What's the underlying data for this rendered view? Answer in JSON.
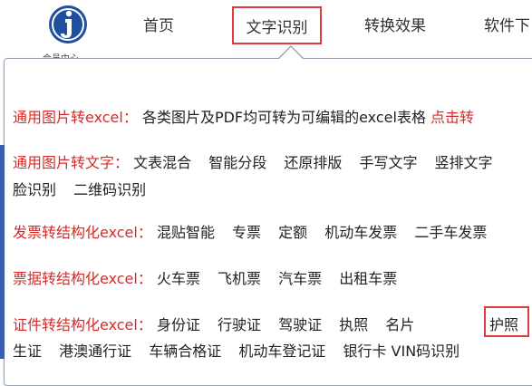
{
  "nav": {
    "logo_caption": "会员中心",
    "items": [
      "首页",
      "文字识别",
      "转换效果",
      "软件下"
    ],
    "active": "文字识别"
  },
  "menu": {
    "row1": {
      "title": "通用图片转excel：",
      "text": "各类图片及PDF均可转为可编辑的excel表格",
      "accent": "点击转"
    },
    "row2": {
      "title": "通用图片转文字：",
      "items": [
        "文表混合",
        "智能分段",
        "还原排版",
        "手写文字",
        "竖排文字"
      ],
      "cont": [
        "脸识别",
        "二维码识别"
      ]
    },
    "row3": {
      "title": "发票转结构化excel：",
      "items": [
        "混贴智能",
        "专票",
        "定额",
        "机动车发票",
        "二手车发票"
      ]
    },
    "row4": {
      "title": "票据转结构化excel：",
      "items": [
        "火车票",
        "飞机票",
        "汽车票",
        "出租车票"
      ]
    },
    "row5": {
      "title": "证件转结构化excel：",
      "items": [
        "身份证",
        "行驶证",
        "驾驶证",
        "执照",
        "名片",
        "护照"
      ],
      "cont": [
        "生证",
        "港澳通行证",
        "车辆合格证",
        "机动车登记证",
        "银行卡 VIN码识别"
      ]
    }
  },
  "colors": {
    "accent": "#d52a2a",
    "highlight": "#e03a3a",
    "logo": "#1f4fa0"
  }
}
